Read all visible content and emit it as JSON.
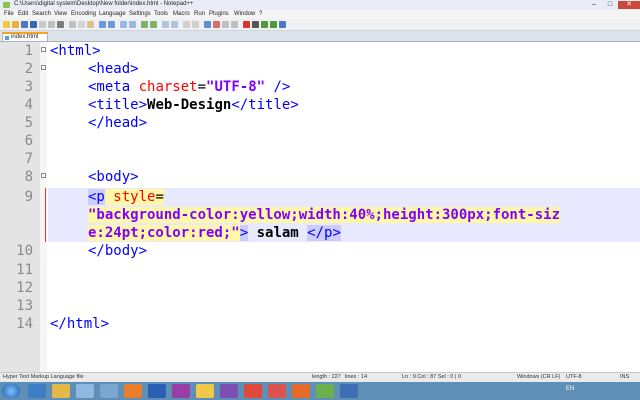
{
  "window": {
    "title": "C:\\Users\\digital system\\Desktop\\New folder\\index.html - Notepad++"
  },
  "menu": [
    "File",
    "Edit",
    "Search",
    "View",
    "Encoding",
    "Language",
    "Settings",
    "Tools",
    "Macro",
    "Run",
    "Plugins",
    "Window",
    "?"
  ],
  "tab": {
    "label": "index.html"
  },
  "editor": {
    "line_numbers": [
      "1",
      "2",
      "3",
      "4",
      "5",
      "6",
      "7",
      "8",
      "9",
      "10",
      "11",
      "12",
      "13",
      "14"
    ]
  },
  "statusbar": {
    "file_type": "Hyper Text Markup Language file",
    "length": "length : 227",
    "lines": "lines : 14",
    "position": "Ln : 9    Col : 87    Sel : 0 | 0",
    "eol": "Windows (CR LF)",
    "encoding": "UTF-8",
    "mode": "INS"
  },
  "taskbar": {
    "lang": "EN"
  },
  "colors": {
    "tag": "#0000ff",
    "attribute": "#ff0000",
    "string": "#8000ff",
    "current_line": "#e8e8ff",
    "taskbar": "#5f8fb5"
  }
}
